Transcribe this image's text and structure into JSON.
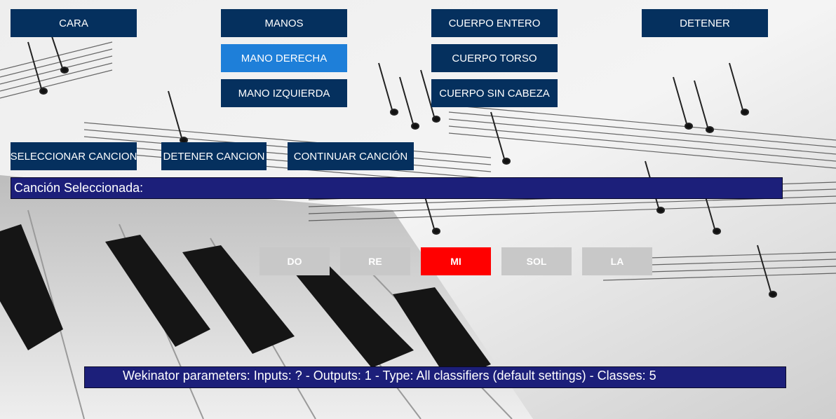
{
  "body_buttons": {
    "cara": "CARA",
    "manos": "MANOS",
    "mano_derecha": "MANO DERECHA",
    "mano_izquierda": "MANO IZQUIERDA",
    "cuerpo_entero": "CUERPO ENTERO",
    "cuerpo_torso": "CUERPO TORSO",
    "cuerpo_sin_cabeza": "CUERPO SIN CABEZA",
    "detener": "DETENER",
    "active": "mano_derecha"
  },
  "song_controls": {
    "seleccionar": "SELECCIONAR CANCION",
    "detener": "DETENER CANCION",
    "continuar": "CONTINUAR CANCIÓN"
  },
  "selected_song": {
    "label": "Canción Seleccionada:"
  },
  "notes": [
    {
      "label": "DO",
      "active": false
    },
    {
      "label": "RE",
      "active": false
    },
    {
      "label": "MI",
      "active": true
    },
    {
      "label": "SOL",
      "active": false
    },
    {
      "label": "LA",
      "active": false
    }
  ],
  "status": {
    "text": "Wekinator parameters: Inputs: ? - Outputs: 1 - Type: All classifiers (default settings) - Classes: 5"
  },
  "colors": {
    "button_navy": "#05305e",
    "button_active": "#1e7fd9",
    "note_active": "#ff0000",
    "note_inactive": "#c8c8c8",
    "banner": "#1c1f7a"
  },
  "background": {
    "description_icon": "sheet-music-piano-photo"
  }
}
